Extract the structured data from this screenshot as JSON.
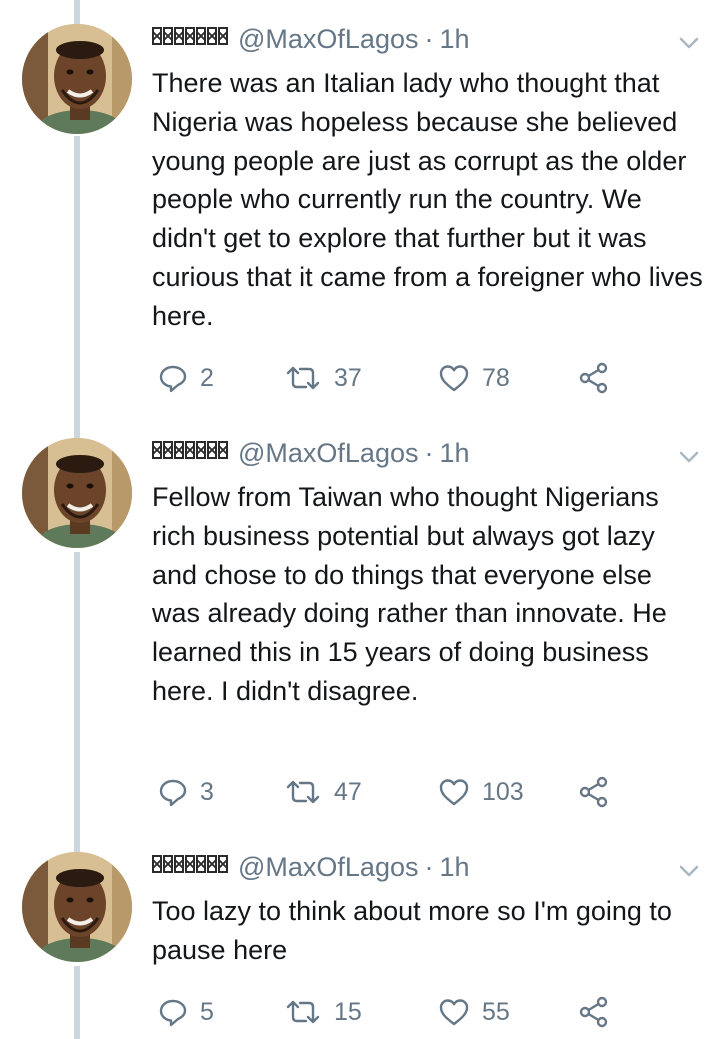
{
  "tweets": [
    {
      "name": "███████",
      "handle": "@MaxOfLagos",
      "separator": "·",
      "time": "1h",
      "text": "There was an Italian lady who thought that Nigeria was hopeless because she believed young people are just as corrupt as the older people who currently run the country. We didn't get to explore that further but it was curious that it came from a foreigner who lives here.",
      "replies": "2",
      "retweets": "37",
      "likes": "78"
    },
    {
      "name": "███████",
      "handle": "@MaxOfLagos",
      "separator": "·",
      "time": "1h",
      "text": "Fellow from Taiwan who thought Nigerians rich business potential but always got lazy and chose to do things that everyone else was already doing rather than innovate. He learned this in 15 years of doing business here. I didn't disagree.",
      "replies": "3",
      "retweets": "47",
      "likes": "103"
    },
    {
      "name": "███████",
      "handle": "@MaxOfLagos",
      "separator": "·",
      "time": "1h",
      "text": "Too lazy to think about more so I'm going to pause here",
      "replies": "5",
      "retweets": "15",
      "likes": "55"
    }
  ],
  "icons": [
    "reply-icon",
    "retweet-icon",
    "like-icon",
    "share-icon",
    "chevron-down-icon"
  ],
  "colors": {
    "text": "#14171a",
    "muted": "#657786",
    "thread_line": "#ccd6dd"
  }
}
